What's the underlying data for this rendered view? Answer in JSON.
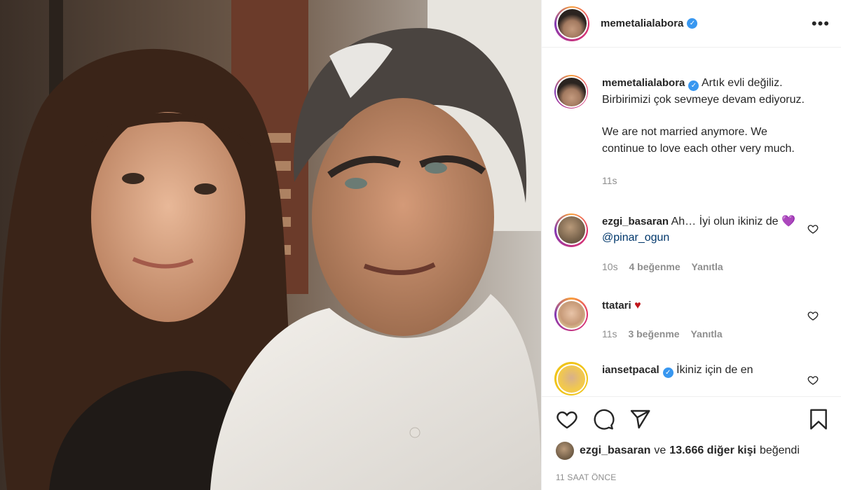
{
  "post": {
    "username": "memetalialabora",
    "verified": true
  },
  "caption": {
    "username": "memetalialabora",
    "text_line1": "Artık evli değiliz. Birbirimizi çok sevmeye devam ediyoruz.",
    "text_line2": "We are not married anymore. We continue to love each other very much.",
    "time": "11s"
  },
  "comments": [
    {
      "username": "ezgi_basaran",
      "text": "Ah… İyi olun ikiniz de",
      "emoji": "💜",
      "mention": "@pinar_ogun",
      "time": "10s",
      "likes": "4 beğenme",
      "reply": "Yanıtla"
    },
    {
      "username": "ttatari",
      "text": "",
      "emoji": "♥",
      "time": "11s",
      "likes": "3 beğenme",
      "reply": "Yanıtla"
    },
    {
      "username": "iansetpacal",
      "text": "İkiniz için de en"
    }
  ],
  "likes_line": {
    "user": "ezgi_basaran",
    "connector": "ve",
    "count_text": "13.666 diğer kişi",
    "suffix": "beğendi"
  },
  "timestamp": "11 SAAT ÖNCE",
  "icons": {
    "more": "more-options-icon",
    "like": "heart-icon",
    "comment": "comment-icon",
    "share": "share-icon",
    "save": "bookmark-icon"
  },
  "colors": {
    "verified": "#3897f0",
    "mention": "#00376b",
    "meta": "#8e8e8e"
  }
}
